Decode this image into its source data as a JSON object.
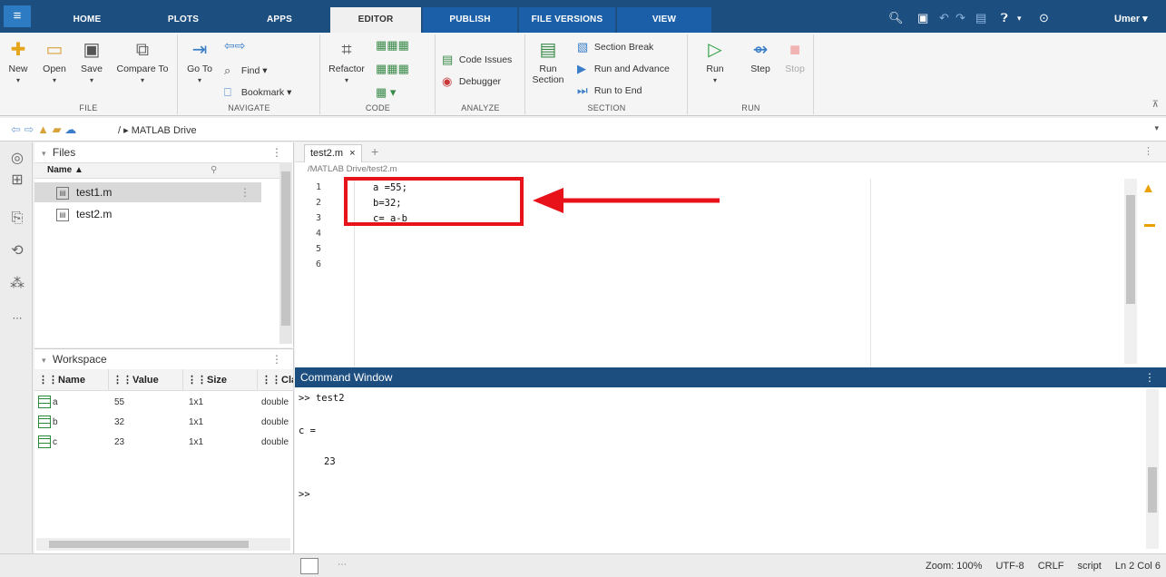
{
  "menubar": {
    "menu_icon": "hamburger-icon",
    "tabs": [
      {
        "label": "HOME"
      },
      {
        "label": "PLOTS"
      },
      {
        "label": "APPS"
      },
      {
        "label": "EDITOR"
      },
      {
        "label": "PUBLISH"
      },
      {
        "label": "FILE VERSIONS"
      },
      {
        "label": "VIEW"
      }
    ],
    "active_tab": "EDITOR",
    "user": "Umer ▾"
  },
  "toolstrip": {
    "file": {
      "group_label": "FILE",
      "new": "New",
      "open": "Open",
      "save": "Save",
      "compare": "Compare To"
    },
    "navigate": {
      "group_label": "NAVIGATE",
      "goto": "Go To",
      "find": "Find",
      "bookmark": "Bookmark"
    },
    "code": {
      "group_label": "CODE",
      "refactor": "Refactor"
    },
    "analyze": {
      "group_label": "ANALYZE",
      "code_issues": "Code Issues",
      "debugger": "Debugger"
    },
    "section": {
      "group_label": "SECTION",
      "run_section_line1": "Run",
      "run_section_line2": "Section",
      "section_break": "Section Break",
      "run_and_advance": "Run and Advance",
      "run_to_end": "Run to End"
    },
    "run": {
      "group_label": "RUN",
      "run": "Run",
      "step": "Step",
      "stop": "Stop"
    }
  },
  "addressbar": {
    "path": "/ ▸ MATLAB Drive"
  },
  "files": {
    "title": "Files",
    "column_name": "Name ▲",
    "items": [
      {
        "name": "test1.m"
      },
      {
        "name": "test2.m"
      }
    ]
  },
  "workspace": {
    "title": "Workspace",
    "columns": [
      "Name",
      "Value",
      "Size",
      "Class"
    ],
    "rows": [
      {
        "name": "a",
        "value": "55",
        "size": "1x1",
        "class": "double"
      },
      {
        "name": "b",
        "value": "32",
        "size": "1x1",
        "class": "double"
      },
      {
        "name": "c",
        "value": "23",
        "size": "1x1",
        "class": "double"
      }
    ]
  },
  "editor": {
    "tab_label": "test2.m",
    "breadcrumb": "/MATLAB Drive/test2.m",
    "line_numbers": [
      "1",
      "2",
      "3",
      "4",
      "5",
      "6"
    ],
    "lines": [
      "a =55;",
      "b=32;",
      "c= a-b"
    ],
    "annotation_color": "#e8121a"
  },
  "command_window": {
    "title": "Command Window",
    "lines": [
      ">> test2",
      "c =",
      "23",
      ">>"
    ]
  },
  "statusbar": {
    "zoom": "Zoom: 100%",
    "encoding": "UTF-8",
    "eol": "CRLF",
    "type": "script",
    "position": "Ln 2 Col 6"
  }
}
